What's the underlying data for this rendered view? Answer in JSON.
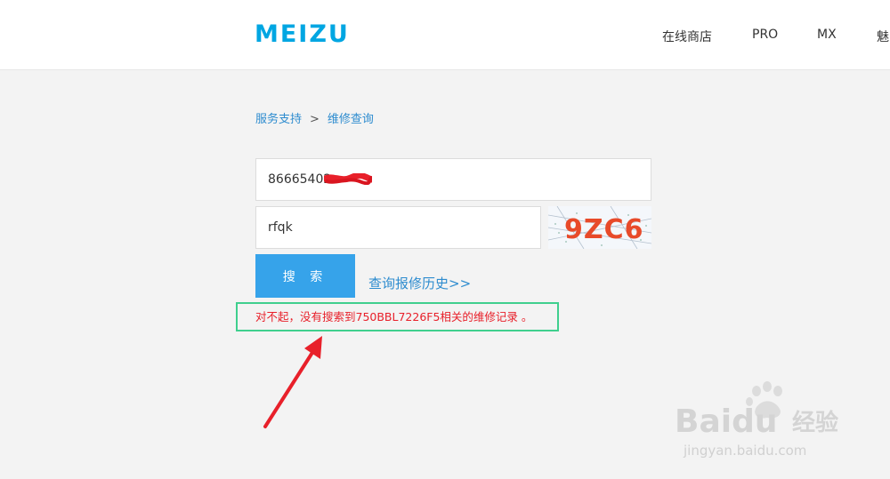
{
  "header": {
    "logo_text": "MEIZU",
    "nav": [
      "在线商店",
      "PRO",
      "MX",
      "魅"
    ]
  },
  "breadcrumb": {
    "root": "服务支持",
    "separator": ">",
    "current": "维修查询"
  },
  "form": {
    "imei_value": "86665402",
    "captcha_value": "rfqk",
    "captcha_image_text": "9ZC6",
    "search_label": "搜 索",
    "history_link": "查询报修历史>>"
  },
  "error": {
    "message": "对不起，没有搜索到750BBL7226F5相关的维修记录 。"
  },
  "watermark": {
    "brand": "Baidu",
    "product": "经验",
    "url": "jingyan.baidu.com"
  },
  "colors": {
    "logo": "#00a6e2",
    "accent": "#36a3ea",
    "link": "#2e8ccf",
    "error": "#e8202a",
    "highlight_box": "#3fcf8e",
    "arrow": "#e8202a"
  },
  "icons": {
    "annotation": "arrow-icon",
    "watermark": "paw-icon"
  }
}
